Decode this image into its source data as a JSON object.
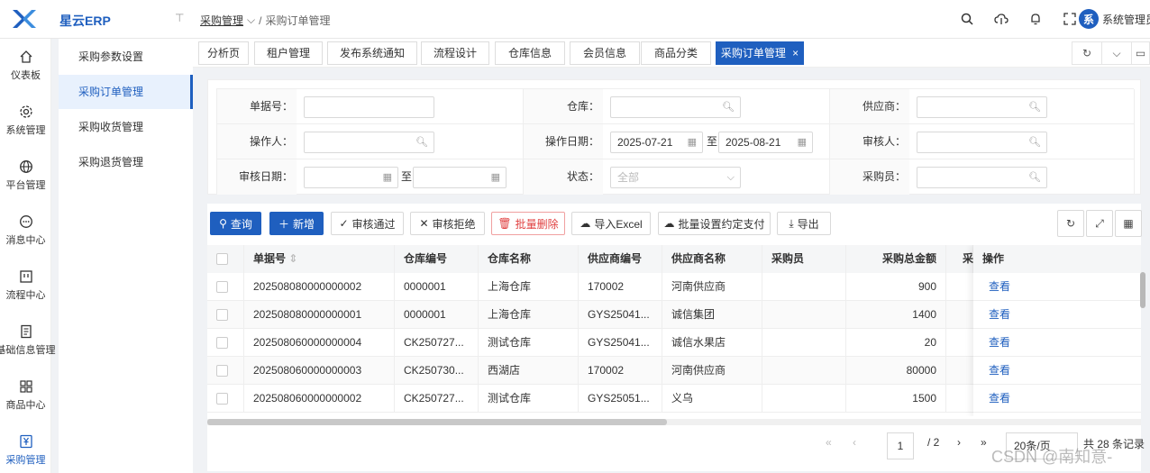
{
  "app": {
    "name": "星云ERP"
  },
  "breadcrumb": {
    "parent": "采购管理",
    "current": "采购订单管理",
    "sep": "/"
  },
  "user": {
    "avatar": "系",
    "name": "系统管理员"
  },
  "nav": [
    {
      "label": "仪表板",
      "icon": "home-icon"
    },
    {
      "label": "系统管理",
      "icon": "gear-icon"
    },
    {
      "label": "平台管理",
      "icon": "globe-icon"
    },
    {
      "label": "消息中心",
      "icon": "message-icon"
    },
    {
      "label": "流程中心",
      "icon": "flow-icon"
    },
    {
      "label": "基础信息管理",
      "icon": "document-icon"
    },
    {
      "label": "商品中心",
      "icon": "grid-icon"
    },
    {
      "label": "采购管理",
      "icon": "yen-icon"
    }
  ],
  "subnav": [
    {
      "label": "采购参数设置"
    },
    {
      "label": "采购订单管理"
    },
    {
      "label": "采购收货管理"
    },
    {
      "label": "采购退货管理"
    }
  ],
  "tabs": [
    {
      "label": "分析页"
    },
    {
      "label": "租户管理"
    },
    {
      "label": "发布系统通知"
    },
    {
      "label": "流程设计"
    },
    {
      "label": "仓库信息"
    },
    {
      "label": "会员信息"
    },
    {
      "label": "商品分类"
    },
    {
      "label": "采购订单管理",
      "close": "×"
    }
  ],
  "filters": {
    "doc_no": "单据号：",
    "warehouse": "仓库：",
    "supplier": "供应商：",
    "operator": "操作人：",
    "op_date": "操作日期：",
    "op_date_from": "2025-07-21",
    "to": "至",
    "op_date_to": "2025-08-21",
    "auditor": "审核人：",
    "audit_date": "审核日期：",
    "status": "状态：",
    "status_value": "全部",
    "buyer": "采购员："
  },
  "toolbar": {
    "query": "查询",
    "add": "新增",
    "approve": "审核通过",
    "reject": "审核拒绝",
    "batch_delete": "批量删除",
    "import": "导入Excel",
    "batch_pay": "批量设置约定支付",
    "export": "导出"
  },
  "table": {
    "headers": [
      "单据号",
      "仓库编号",
      "仓库名称",
      "供应商编号",
      "供应商名称",
      "采购员",
      "采购总金额",
      "采",
      "操作"
    ],
    "rows": [
      {
        "doc": "202508080000000002",
        "wh_code": "0000001",
        "wh_name": "上海仓库",
        "sup_code": "170002",
        "sup_name": "河南供应商",
        "buyer": "",
        "amount": "900",
        "op": "查看"
      },
      {
        "doc": "202508080000000001",
        "wh_code": "0000001",
        "wh_name": "上海仓库",
        "sup_code": "GYS25041...",
        "sup_name": "诚信集团",
        "buyer": "",
        "amount": "1400",
        "op": "查看"
      },
      {
        "doc": "202508060000000004",
        "wh_code": "CK250727...",
        "wh_name": "测试仓库",
        "sup_code": "GYS25041...",
        "sup_name": "诚信水果店",
        "buyer": "",
        "amount": "20",
        "op": "查看"
      },
      {
        "doc": "202508060000000003",
        "wh_code": "CK250730...",
        "wh_name": "西湖店",
        "sup_code": "170002",
        "sup_name": "河南供应商",
        "buyer": "",
        "amount": "80000",
        "op": "查看"
      },
      {
        "doc": "202508060000000002",
        "wh_code": "CK250727...",
        "wh_name": "测试仓库",
        "sup_code": "GYS25051...",
        "sup_name": "义乌",
        "buyer": "",
        "amount": "1500",
        "op": "查看"
      }
    ]
  },
  "pager": {
    "page": "1",
    "total_pages": "/ 2",
    "page_size": "20条/页",
    "total": "共 28 条记录"
  },
  "watermark": "CSDN @南知意-"
}
